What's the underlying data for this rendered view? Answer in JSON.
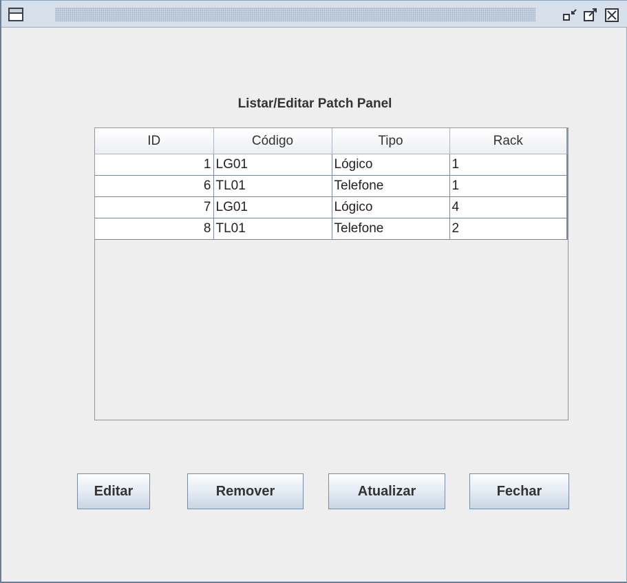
{
  "window": {
    "title": ""
  },
  "dialog": {
    "title": "Listar/Editar Patch Panel"
  },
  "table": {
    "columns": [
      "ID",
      "Código",
      "Tipo",
      "Rack"
    ],
    "rows": [
      [
        "1",
        "LG01",
        "Lógico",
        "1"
      ],
      [
        "6",
        "TL01",
        "Telefone",
        "1"
      ],
      [
        "7",
        "LG01",
        "Lógico",
        "4"
      ],
      [
        "8",
        "TL01",
        "Telefone",
        "2"
      ]
    ]
  },
  "buttons": {
    "edit": "Editar",
    "remove": "Remover",
    "refresh": "Atualizar",
    "close": "Fechar"
  },
  "icons": {
    "menu": "window-menu-icon",
    "minimize": "minimize-icon",
    "maximize": "maximize-icon",
    "close": "close-icon"
  }
}
